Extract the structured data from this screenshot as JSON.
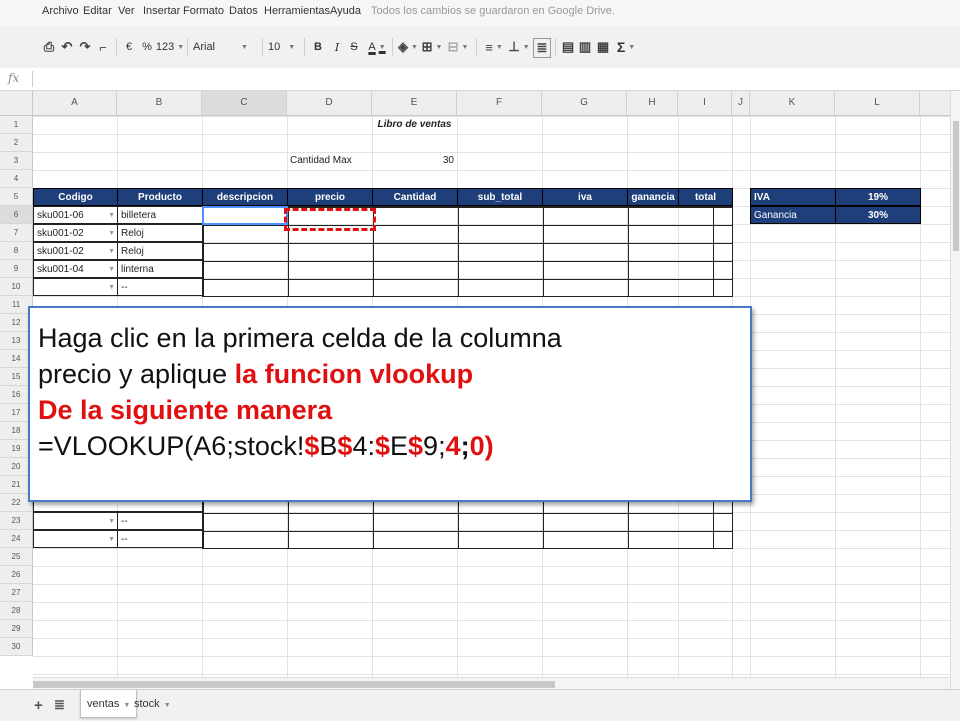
{
  "menu": {
    "items": [
      "Archivo",
      "Editar",
      "Ver",
      "Insertar",
      "Formato",
      "Datos",
      "Herramientas",
      "Ayuda"
    ],
    "status": "Todos los cambios se guardaron en Google Drive."
  },
  "toolbar": {
    "currency": "€",
    "percent": "%",
    "number_format": "123",
    "font": "Arial",
    "font_size": "10",
    "bold": "B",
    "italic": "I",
    "strike": "S",
    "text_color": "A",
    "sigma": "Σ"
  },
  "formula_bar": {
    "fx": "fx",
    "value": ""
  },
  "columns": [
    "A",
    "B",
    "C",
    "D",
    "E",
    "F",
    "G",
    "H",
    "I",
    "J",
    "K",
    "L"
  ],
  "rows": [
    "1",
    "2",
    "3",
    "4",
    "5",
    "6",
    "7",
    "8",
    "9",
    "10",
    "11",
    "12",
    "13",
    "14",
    "15",
    "16",
    "17",
    "18",
    "19",
    "20",
    "21",
    "22",
    "23",
    "24",
    "25",
    "26",
    "27",
    "28",
    "29",
    "30"
  ],
  "sheet": {
    "title": "Libro de ventas",
    "cantidad_max_label": "Cantidad Max",
    "cantidad_max_value": "30",
    "headers": [
      "Codigo",
      "Producto",
      "descripcion",
      "precio",
      "Cantidad",
      "sub_total",
      "iva",
      "ganancia",
      "total"
    ],
    "data_rows": [
      {
        "codigo": "sku001-06",
        "producto": "billetera"
      },
      {
        "codigo": "sku001-02",
        "producto": "Reloj"
      },
      {
        "codigo": "sku001-02",
        "producto": "Reloj"
      },
      {
        "codigo": "sku001-04",
        "producto": "linterna"
      },
      {
        "codigo": "",
        "producto": "--"
      }
    ],
    "lower_rows": [
      {
        "codigo": "",
        "producto": "--"
      },
      {
        "codigo": "",
        "producto": "--"
      }
    ],
    "side_table": [
      {
        "label": "IVA",
        "value": "19%"
      },
      {
        "label": "Ganancia",
        "value": "30%"
      }
    ]
  },
  "callout": {
    "line1": "Haga clic en la primera celda de la columna",
    "line2_plain": "precio y aplique ",
    "line2_red": "la funcion vlookup",
    "line3": "De la siguiente manera",
    "formula": {
      "p1": "=VLOOKUP(A6;stock!",
      "d1": "$",
      "p2": "B",
      "d2": "$",
      "p3": "4:",
      "d3": "$",
      "p4": "E",
      "d4": "$",
      "p5": "9;",
      "p6": "4",
      "p7": ";",
      "p8": "0)"
    }
  },
  "sheet_tabs": [
    "ventas",
    "stock"
  ],
  "colors": {
    "header_fill": "#1f3f7a",
    "accent_red": "#e01010",
    "callout_border": "#4a78c2"
  }
}
